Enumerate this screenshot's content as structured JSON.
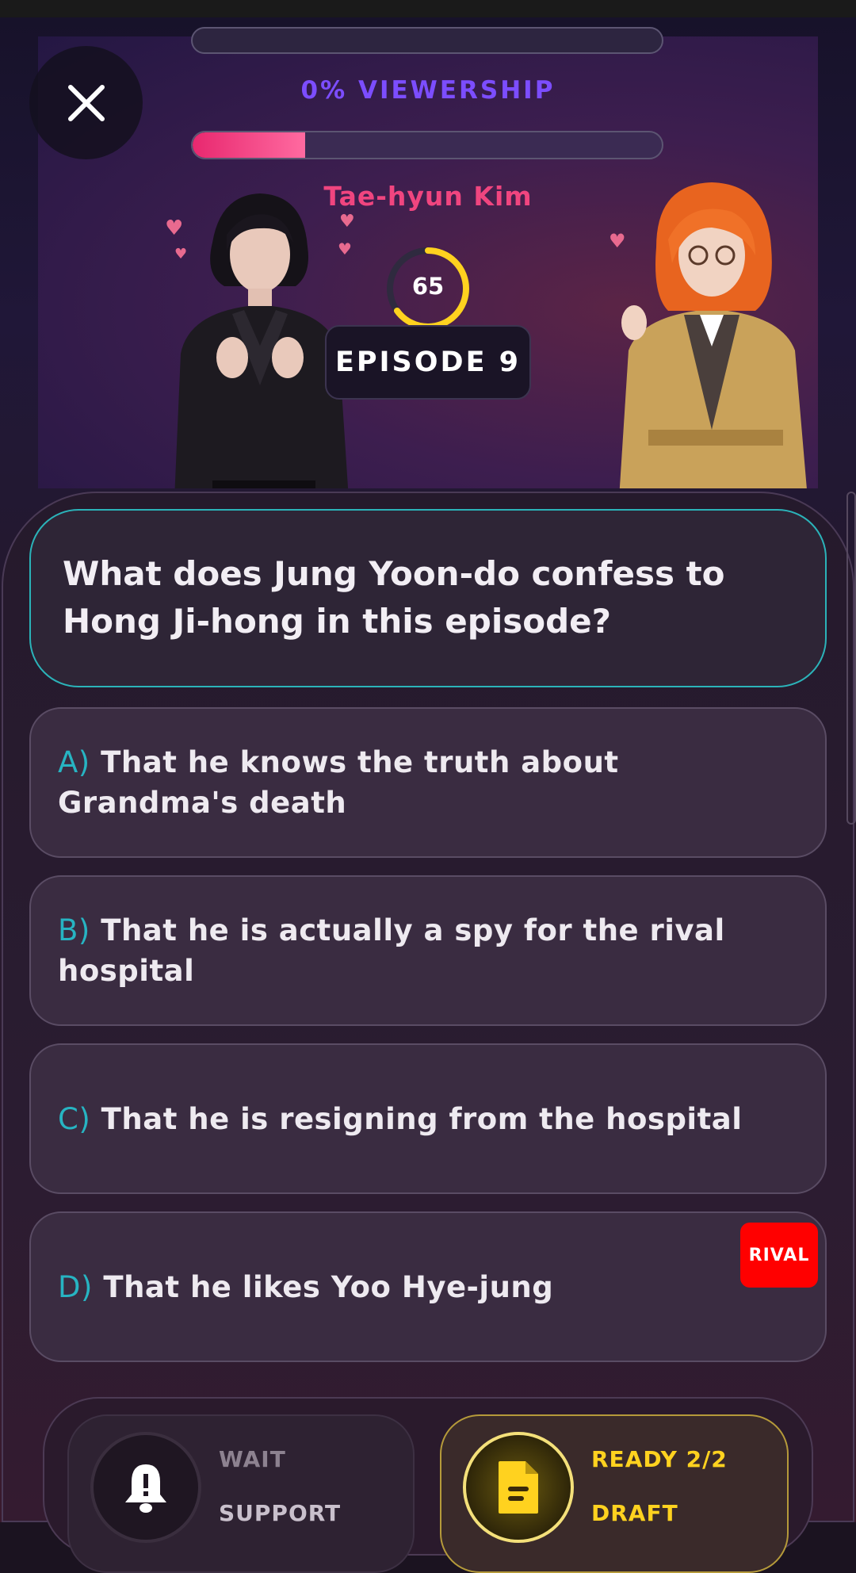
{
  "header": {
    "viewership_label": "0% VIEWERSHIP",
    "viewership_percent": 24,
    "character_name": "Tae-hyun Kim",
    "timer_value": "65",
    "timer_fraction": 0.65,
    "episode_label": "EPISODE 9"
  },
  "question": {
    "text": "What does Jung Yoon-do confess to Hong Ji-hong in this episode?"
  },
  "options": [
    {
      "letter": "A)",
      "text": "That he knows the truth about Grandma's death"
    },
    {
      "letter": "B)",
      "text": "That he is actually a spy for the rival hospital"
    },
    {
      "letter": "C)",
      "text": "That he is resigning from the hospital"
    },
    {
      "letter": "D)",
      "text": "That he likes Yoo Hye-jung"
    }
  ],
  "rival_badge": "RIVAL",
  "actions": {
    "wait": {
      "status": "WAIT",
      "label": "SUPPORT",
      "icon": "bell-alert-icon"
    },
    "ready": {
      "status": "READY 2/2",
      "label": "DRAFT",
      "icon": "document-icon"
    }
  },
  "colors": {
    "accent_purple": "#7c4dff",
    "accent_pink": "#f0457f",
    "accent_teal": "#27b4c2",
    "timer_yellow": "#ffd21f",
    "rival_red": "#ff0000",
    "ready_gold": "#ffd21f"
  }
}
